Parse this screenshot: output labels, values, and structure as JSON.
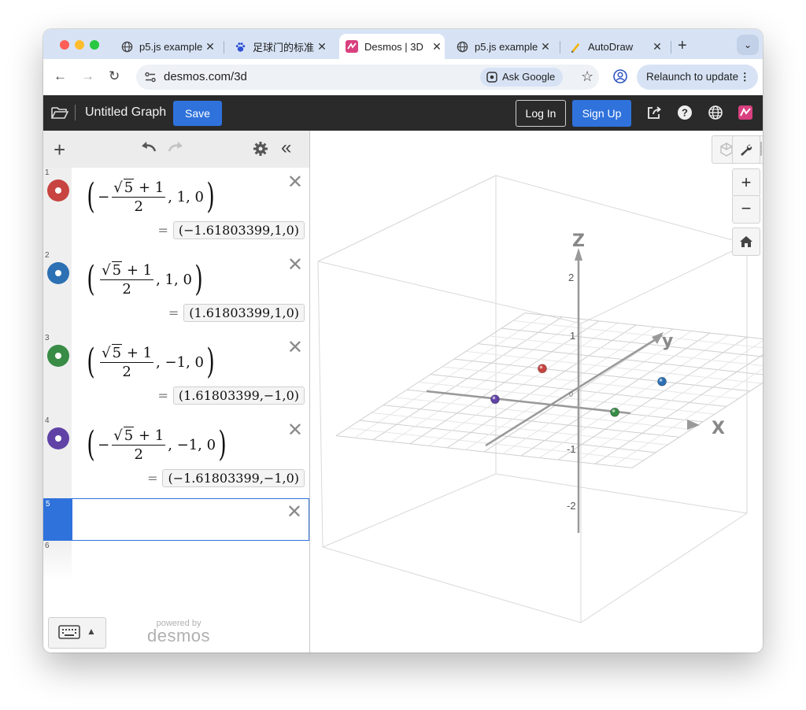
{
  "browser": {
    "tabs": [
      {
        "title": "p5.js example",
        "favicon": "globe-icon",
        "active": false
      },
      {
        "title": "足球门的标准",
        "favicon": "baidu-paw-icon",
        "active": false
      },
      {
        "title": "Desmos | 3D",
        "favicon": "desmos-icon",
        "active": true
      },
      {
        "title": "p5.js example",
        "favicon": "globe-icon",
        "active": false
      },
      {
        "title": "AutoDraw",
        "favicon": "autodraw-pen-icon",
        "active": false
      }
    ],
    "url": "desmos.com/3d",
    "ask_google": "Ask Google",
    "relaunch": "Relaunch to update"
  },
  "header": {
    "graph_title": "Untitled Graph",
    "save": "Save",
    "login": "Log In",
    "signup": "Sign Up"
  },
  "expressions": [
    {
      "index": "1",
      "color": "#c74440",
      "sign": "−",
      "sqrt_arg": "5",
      "plus": "+ 1",
      "den": "2",
      "tail": ", 1, 0",
      "result": "(−1.61803399,1,0)"
    },
    {
      "index": "2",
      "color": "#2d70b3",
      "sign": "",
      "sqrt_arg": "5",
      "plus": "+ 1",
      "den": "2",
      "tail": ", 1, 0",
      "result": "(1.61803399,1,0)"
    },
    {
      "index": "3",
      "color": "#388c46",
      "sign": "",
      "sqrt_arg": "5",
      "plus": "+ 1",
      "den": "2",
      "tail": ", −1, 0",
      "result": "(1.61803399,−1,0)"
    },
    {
      "index": "4",
      "color": "#6042a6",
      "sign": "−",
      "sqrt_arg": "5",
      "plus": "+ 1",
      "den": "2",
      "tail": ", −1, 0",
      "result": "(−1.61803399,−1,0)"
    },
    {
      "index": "5"
    },
    {
      "index": "6"
    }
  ],
  "footer": {
    "powered_by": "powered by",
    "brand": "desmos"
  },
  "graph": {
    "axis_labels": {
      "x": "x",
      "y": "y",
      "z": "z"
    },
    "z_ticks": [
      "2",
      "1",
      "-1",
      "-2"
    ],
    "points": [
      {
        "x": -1.61803399,
        "y": 1,
        "z": 0,
        "color": "#c74440"
      },
      {
        "x": 1.61803399,
        "y": 1,
        "z": 0,
        "color": "#2d70b3"
      },
      {
        "x": 1.61803399,
        "y": -1,
        "z": 0,
        "color": "#388c46"
      },
      {
        "x": -1.61803399,
        "y": -1,
        "z": 0,
        "color": "#6042a6"
      }
    ],
    "controls": [
      "wrench-icon",
      "zoom-in",
      "zoom-out",
      "home-icon"
    ],
    "zoom_in": "+",
    "zoom_out": "−"
  }
}
